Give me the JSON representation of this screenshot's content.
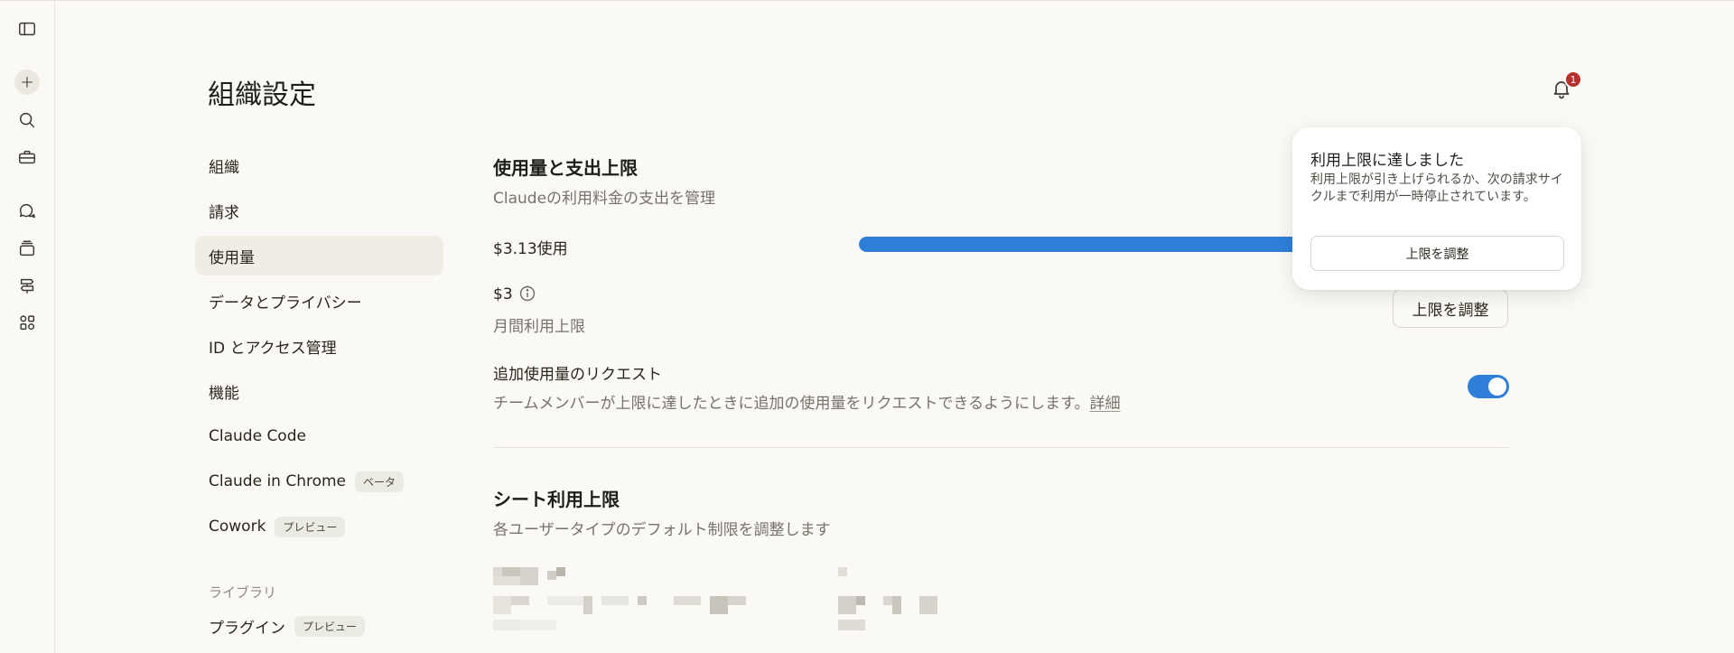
{
  "page": {
    "title": "組織設定"
  },
  "notifications": {
    "count": "1"
  },
  "rail": {
    "icons": [
      "sidebar-toggle-icon",
      "plus-icon",
      "search-icon",
      "toolbox-icon",
      "chat-bubbles-icon",
      "stack-icon",
      "signpost-icon",
      "apps-icon"
    ]
  },
  "nav": {
    "items": [
      {
        "label": "組織"
      },
      {
        "label": "請求"
      },
      {
        "label": "使用量"
      },
      {
        "label": "データとプライバシー"
      },
      {
        "label": "ID とアクセス管理"
      },
      {
        "label": "機能"
      },
      {
        "label": "Claude Code"
      },
      {
        "label": "Claude in Chrome",
        "tag": "ベータ"
      },
      {
        "label": "Cowork",
        "tag": "プレビュー"
      }
    ],
    "library_heading": "ライブラリ",
    "library_items": [
      {
        "label": "プラグイン",
        "tag": "プレビュー"
      }
    ]
  },
  "usage": {
    "title": "使用量と支出上限",
    "subtitle": "Claudeの利用料金の支出を管理",
    "used_label": "$3.13使用",
    "used_fraction": 1.0,
    "limit_amount": "$3",
    "limit_caption": "月間利用上限",
    "adjust_button": "上限を調整",
    "extra_request_title": "追加使用量のリクエスト",
    "extra_request_desc": "チームメンバーが上限に達したときに追加の使用量をリクエストできるようにします。",
    "extra_request_link": "詳細",
    "extra_request_enabled": true
  },
  "seats": {
    "title": "シート利用上限",
    "subtitle": "各ユーザータイプのデフォルト制限を調整します"
  },
  "popover": {
    "title": "利用上限に達しました",
    "body": "利用上限が引き上げられるか、次の請求サイクルまで利用が一時停止されています。",
    "button": "上限を調整"
  },
  "colors": {
    "accent": "#2f7fd9",
    "badge": "#b7302b",
    "background": "#faf9f5"
  }
}
